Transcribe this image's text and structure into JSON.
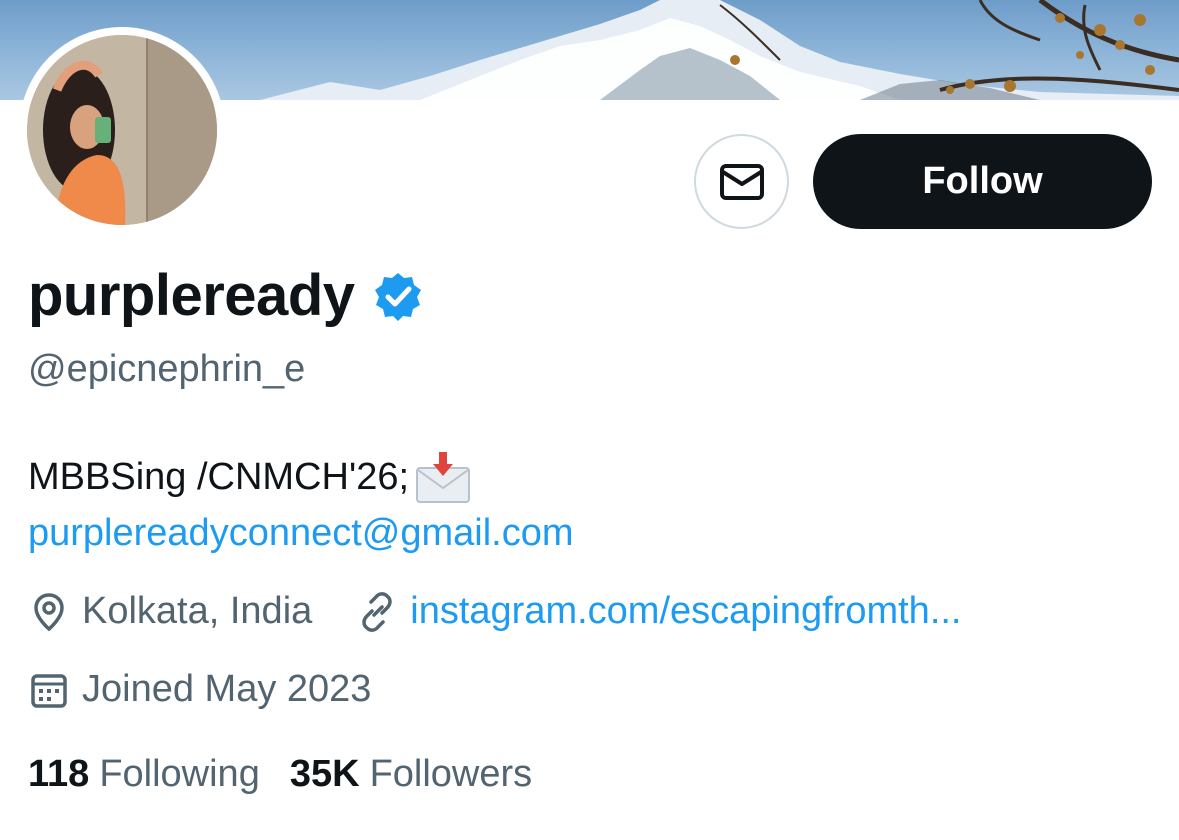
{
  "profile": {
    "display_name": "purpleready",
    "handle": "@epicnephrin_e",
    "bio_text": "MBBSing /CNMCH'26;",
    "bio_email": "purplereadyconnect@gmail.com",
    "location": "Kolkata, India",
    "website": "instagram.com/escapingfromth...",
    "joined": "Joined May 2023"
  },
  "actions": {
    "follow_label": "Follow"
  },
  "stats": {
    "following_count": "118",
    "following_label": "Following",
    "followers_count": "35K",
    "followers_label": "Followers"
  },
  "icons": {
    "message": "envelope-icon",
    "verified": "verified-badge-icon",
    "location": "location-pin-icon",
    "website": "link-icon",
    "joined": "calendar-icon",
    "bio_emoji": "envelope-with-arrow-emoji"
  },
  "colors": {
    "accent": "#1d9bf0",
    "text_primary": "#0f1419",
    "text_secondary": "#536471",
    "button_dark": "#0f1419",
    "border": "#cfd9de"
  }
}
